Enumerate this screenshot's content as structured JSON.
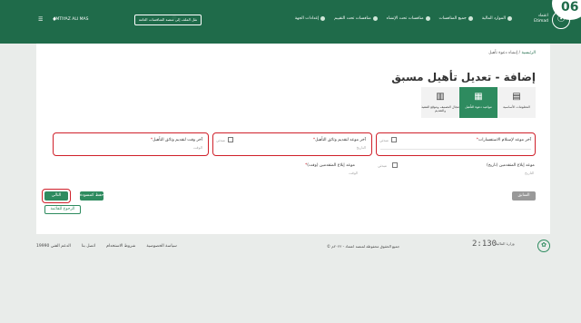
{
  "header": {
    "logo_glyph": "☉",
    "logo_text": "اعتماد Etimad",
    "nav": [
      {
        "label": "الموارد المالية"
      },
      {
        "label": "جميع المنافسات"
      },
      {
        "label": "منافسات تحت الإنشاء"
      },
      {
        "label": "منافسات تحت التقييم"
      },
      {
        "label": "إعدادات الجهة"
      }
    ],
    "user_name": "IMTIYAZ ALI MAS",
    "switch_button": "نقل الملف إلى منصة المنافسات العامة",
    "icons": "☰ ♦",
    "corner_badge": "06"
  },
  "breadcrumb": {
    "home": "الرئيسية",
    "separator": " / ",
    "current": "إنشاء دعوة تأهيل"
  },
  "page_title": "إضافة - تعديل تأهيل مسبق",
  "steps": [
    {
      "icon": "▤",
      "label": "المعلومات الأساسية",
      "active": false
    },
    {
      "icon": "▦",
      "label": "مواعيد دعوة التأهيل",
      "active": true
    },
    {
      "icon": "▥",
      "label": "مجال التصنيف وموقع التنفيذ والتقديم",
      "active": false
    }
  ],
  "fields": {
    "inquiry_deadline": {
      "label": "آخر موعد لإستلام الاستفسارات",
      "checkbox": "مبدئي",
      "hint": ""
    },
    "submission_deadline": {
      "label": "آخر موعد لتقديم وثائق التأهيل",
      "checkbox": "مبدئي",
      "hint": "التاريخ"
    },
    "submission_time": {
      "label": "آخر وقت لتقديم وثائق التأهيل",
      "hint": "الوقت"
    },
    "notify_date": {
      "label": "موعد إبلاغ المتقدمين (تاريخ)",
      "checkbox": "مبدئي",
      "hint": "التاريخ"
    },
    "notify_time": {
      "label": "موعد إبلاغ المتقدمين (وقت)",
      "hint": "الوقت"
    }
  },
  "buttons": {
    "next": "التالي",
    "save_draft": "حفظ كمسودة",
    "back": "السابق",
    "return_list": "الرجوع للقائمة"
  },
  "footer": {
    "links": [
      "اتصل بنا",
      "شروط الاستخدام",
      "سياسة الخصوصية"
    ],
    "support": "الدعم الفني 19990",
    "copyright": "© جميع الحقوق محفوظة لمنصة اعتماد - ٢٠٢٢م",
    "clock": "2:130",
    "sublogo": "وزارة المالية",
    "logo_glyph": "✿"
  }
}
